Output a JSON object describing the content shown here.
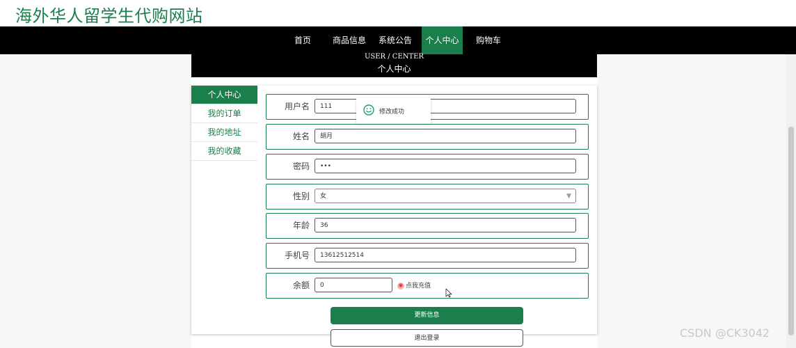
{
  "site": {
    "title": "海外华人留学生代购网站"
  },
  "nav": {
    "items": [
      {
        "label": "首页"
      },
      {
        "label": "商品信息"
      },
      {
        "label": "系统公告"
      },
      {
        "label": "个人中心"
      },
      {
        "label": "购物车"
      }
    ],
    "active_index": 3
  },
  "banner": {
    "title_en": "USER / CENTER",
    "title_cn": "个人中心"
  },
  "sidebar": {
    "items": [
      {
        "label": "个人中心"
      },
      {
        "label": "我的订单"
      },
      {
        "label": "我的地址"
      },
      {
        "label": "我的收藏"
      }
    ],
    "active_index": 0
  },
  "form": {
    "username": {
      "label": "用户名",
      "value": "111"
    },
    "name": {
      "label": "姓名",
      "value": "胡月"
    },
    "password": {
      "label": "密码",
      "value": "•••"
    },
    "gender": {
      "label": "性别",
      "value": "女"
    },
    "age": {
      "label": "年龄",
      "value": "36"
    },
    "phone": {
      "label": "手机号",
      "value": "13612512514"
    },
    "balance": {
      "label": "余额",
      "value": "0",
      "recharge_label": "点我充值"
    }
  },
  "buttons": {
    "update": "更新信息",
    "logout": "退出登录"
  },
  "toast": {
    "message": "修改成功"
  },
  "watermark": {
    "text": "CSDN @CK3042"
  },
  "colors": {
    "accent": "#1a7f4b",
    "nav_bg": "#000000"
  }
}
